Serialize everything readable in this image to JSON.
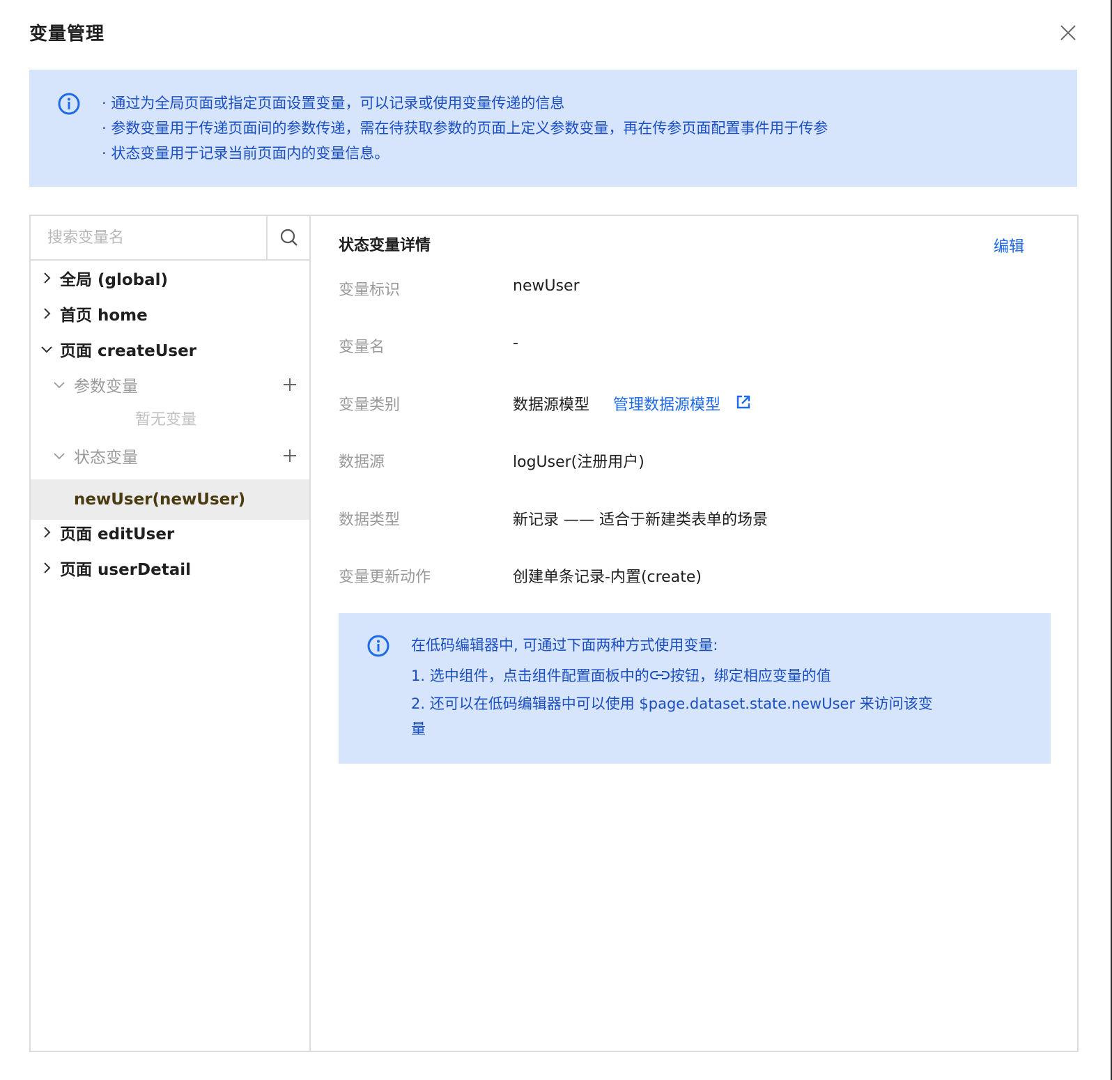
{
  "dialog": {
    "title": "变量管理"
  },
  "top_notice": {
    "lines": [
      "· 通过为全局页面或指定页面设置变量，可以记录或使用变量传递的信息",
      "· 参数变量用于传递页面间的参数传递，需在待获取参数的页面上定义参数变量，再在传参页面配置事件用于传参",
      "· 状态变量用于记录当前页面内的变量信息。"
    ]
  },
  "search": {
    "placeholder": "搜索变量名"
  },
  "tree": {
    "global": "全局 (global)",
    "home": "首页 home",
    "create_user": "页面 createUser",
    "param_vars": "参数变量",
    "param_empty": "暂无变量",
    "state_vars": "状态变量",
    "selected_var": "newUser(newUser)",
    "edit_user": "页面 editUser",
    "user_detail": "页面 userDetail"
  },
  "detail": {
    "title": "状态变量详情",
    "edit_label": "编辑",
    "rows": [
      {
        "key": "变量标识",
        "value": "newUser"
      },
      {
        "key": "变量名",
        "value": "-"
      },
      {
        "key": "变量类别",
        "value": "数据源模型",
        "link": "管理数据源模型"
      },
      {
        "key": "数据源",
        "value": "logUser(注册用户)"
      },
      {
        "key": "数据类型",
        "value": "新记录 —— 适合于新建类表单的场景"
      },
      {
        "key": "变量更新动作",
        "value": "创建单条记录-内置(create)"
      }
    ]
  },
  "usage": {
    "intro": "在低码编辑器中, 可通过下面两种方式使用变量:",
    "item1_before": "1. 选中组件，点击组件配置面板中的",
    "item1_after": "按钮，绑定相应变量的值",
    "item2_line1": "2. 还可以在低码编辑器中可以使用 $page.dataset.state.newUser 来访问该变",
    "item2_line2": "量"
  },
  "colors": {
    "accent": "#1e6ae8",
    "notice_bg": "#d6e4fc",
    "notice_text": "#1b4fc1",
    "selected_bg": "#ececec"
  }
}
